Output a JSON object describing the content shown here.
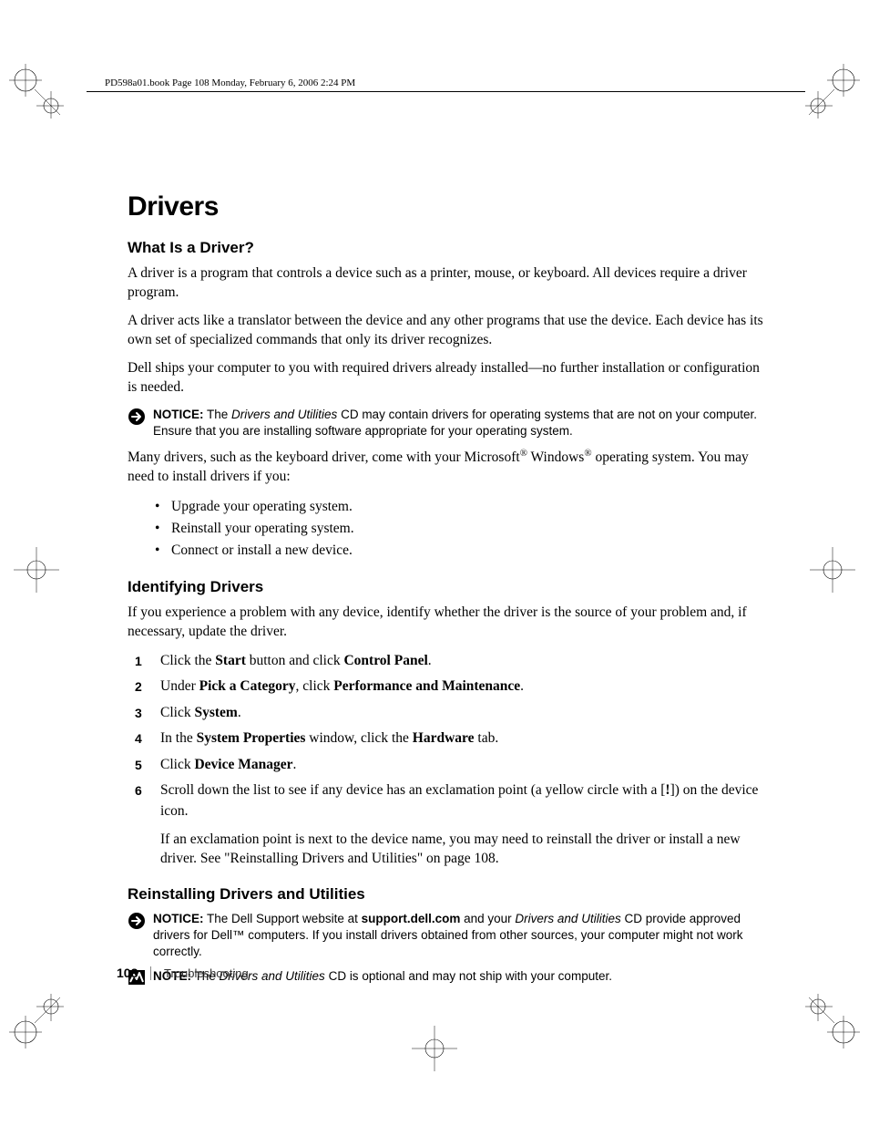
{
  "header": {
    "text": "PD598a01.book  Page 108  Monday, February 6, 2006  2:24 PM"
  },
  "h1": "Drivers",
  "sec1": {
    "title": "What Is a Driver?",
    "p1": "A driver is a program that controls a device such as a printer, mouse, or keyboard. All devices require a driver program.",
    "p2": "A driver acts like a translator between the device and any other programs that use the device. Each device has its own set of specialized commands that only its driver recognizes.",
    "p3": "Dell ships your computer to you with required drivers already installed—no further installation or configuration is needed.",
    "notice_label": "NOTICE:",
    "notice_pre": " The ",
    "notice_em": "Drivers and Utilities",
    "notice_post": " CD may contain drivers for operating systems that are not on your computer. Ensure that you are installing software appropriate for your operating system.",
    "p4_pre": "Many drivers, such as the keyboard driver, come with your Microsoft",
    "p4_reg": "®",
    "p4_mid": " Windows",
    "p4_reg2": "®",
    "p4_post": " operating system. You may need to install drivers if you:",
    "bullets": [
      "Upgrade your operating system.",
      "Reinstall your operating system.",
      "Connect or install a new device."
    ]
  },
  "sec2": {
    "title": "Identifying Drivers",
    "p1": "If you experience a problem with any device, identify whether the driver is the source of your problem and, if necessary, update the driver.",
    "steps": [
      {
        "pre": "Click the ",
        "b1": "Start",
        "mid": " button and click ",
        "b2": "Control Panel",
        "post": "."
      },
      {
        "pre": "Under ",
        "b1": "Pick a Category",
        "mid": ", click ",
        "b2": "Performance and Maintenance",
        "post": "."
      },
      {
        "pre": "Click ",
        "b1": "System",
        "post": "."
      },
      {
        "pre": "In the ",
        "b1": "System Properties",
        "mid": " window, click the ",
        "b2": "Hardware",
        "post": " tab."
      },
      {
        "pre": "Click ",
        "b1": "Device Manager",
        "post": "."
      },
      {
        "pre": "Scroll down the list to see if any device has an exclamation point (a yellow circle with a [",
        "b1": "!",
        "post": "]) on the device icon.",
        "extra": "If an exclamation point is next to the device name, you may need to reinstall the driver or install a new driver. See \"Reinstalling Drivers and Utilities\" on page 108."
      }
    ]
  },
  "sec3": {
    "title": "Reinstalling Drivers and Utilities",
    "notice_label": "NOTICE:",
    "notice_pre": " The Dell Support website at ",
    "notice_b": "support.dell.com",
    "notice_mid": " and your ",
    "notice_em": "Drivers and Utilities",
    "notice_post": " CD provide approved drivers for Dell™ computers. If you install drivers obtained from other sources, your computer might not work correctly.",
    "note_label": "NOTE:",
    "note_pre": " The ",
    "note_em": "Drivers and Utilities",
    "note_post": " CD is optional and may not ship with your computer."
  },
  "footer": {
    "page": "108",
    "section": "Troubleshooting"
  }
}
